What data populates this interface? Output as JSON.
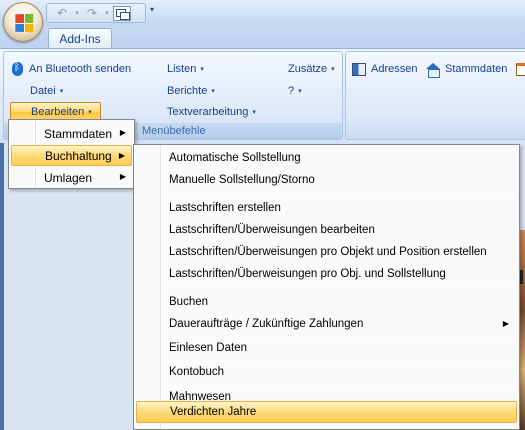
{
  "office_logo": {
    "colors": [
      "#e8462b",
      "#7cb829",
      "#2f7ed8",
      "#f5b400"
    ]
  },
  "quick_access": {
    "undo_icon": "undo-icon",
    "redo_icon": "redo-icon",
    "window_icon": "switch-windows-icon",
    "customize_glyph": "▾"
  },
  "tabs": [
    {
      "label": "Add-Ins",
      "selected": true
    }
  ],
  "ribbon": {
    "group_label": "Menübefehle",
    "col1": {
      "bluetooth": "An Bluetooth senden",
      "datei": "Datei",
      "bearbeiten": "Bearbeiten"
    },
    "col2": {
      "listen": "Listen",
      "berichte": "Berichte",
      "textverarbeitung": "Textverarbeitung"
    },
    "col3": {
      "zusaetze": "Zusätze",
      "help": "?"
    },
    "group2": {
      "adressen": "Adressen",
      "stammdaten": "Stammdaten"
    },
    "dropdown_arrow": "▾"
  },
  "bearbeiten_menu": {
    "items": [
      {
        "label": "Stammdaten",
        "has_submenu": true,
        "highlighted": false
      },
      {
        "label": "Buchhaltung",
        "has_submenu": true,
        "highlighted": true
      },
      {
        "label": "Umlagen",
        "has_submenu": true,
        "highlighted": false
      }
    ],
    "submenu_glyph": "▶"
  },
  "buchhaltung_menu": {
    "items": [
      {
        "label": "Automatische Sollstellung"
      },
      {
        "label": "Manuelle Sollstellung/Storno"
      },
      {
        "label": "Lastschriften erstellen"
      },
      {
        "label": "Lastschriften/Überweisungen bearbeiten"
      },
      {
        "label": "Lastschriften/Überweisungen pro Objekt und Position erstellen"
      },
      {
        "label": "Lastschriften/Überweisungen pro Obj. und Sollstellung"
      },
      {
        "label": "Buchen"
      },
      {
        "label": "Daueraufträge / Zukünftige Zahlungen",
        "has_submenu": true
      },
      {
        "label": "Einlesen Daten"
      },
      {
        "label": "Kontobuch"
      },
      {
        "label": "Mahnwesen"
      },
      {
        "label": "Verdichten Jahre",
        "highlighted": true
      }
    ],
    "submenu_glyph": "▶",
    "highlight_color": "#ffd872"
  }
}
